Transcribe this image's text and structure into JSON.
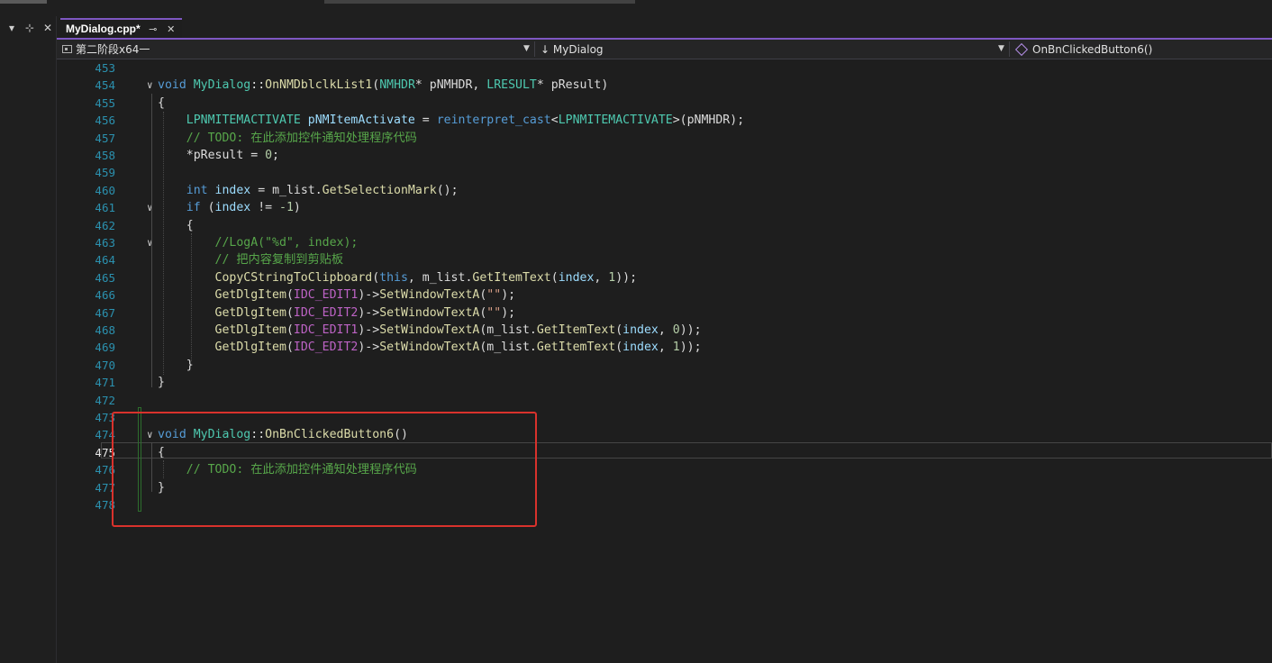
{
  "tab": {
    "title": "MyDialog.cpp*",
    "pin": "⊸",
    "close": "✕"
  },
  "left_panel": {
    "buttons": [
      "▾",
      "⊹",
      "✕"
    ]
  },
  "nav": {
    "project": "第二阶段x64一",
    "class_scope": "↓ MyDialog",
    "member": "OnBnClickedButton6()"
  },
  "code": {
    "current_line": 475,
    "lines": [
      {
        "n": 453,
        "tokens": []
      },
      {
        "n": 454,
        "fold": "v",
        "tokens": [
          [
            "kw",
            "void"
          ],
          [
            "pl",
            " "
          ],
          [
            "ty",
            "MyDialog"
          ],
          [
            "pl",
            "::"
          ],
          [
            "fn",
            "OnNMDblclkList1"
          ],
          [
            "pl",
            "("
          ],
          [
            "ty",
            "NMHDR"
          ],
          [
            "pl",
            "* pNMHDR, "
          ],
          [
            "ty",
            "LRESULT"
          ],
          [
            "pl",
            "* pResult)"
          ]
        ]
      },
      {
        "n": 455,
        "tokens": [
          [
            "pl",
            "{"
          ]
        ]
      },
      {
        "n": 456,
        "tokens": [
          [
            "pl",
            "    "
          ],
          [
            "ty",
            "LPNMITEMACTIVATE"
          ],
          [
            "pl",
            " "
          ],
          [
            "id",
            "pNMItemActivate"
          ],
          [
            "pl",
            " = "
          ],
          [
            "kw",
            "reinterpret_cast"
          ],
          [
            "pl",
            "<"
          ],
          [
            "ty",
            "LPNMITEMACTIVATE"
          ],
          [
            "pl",
            ">(pNMHDR);"
          ]
        ]
      },
      {
        "n": 457,
        "tokens": [
          [
            "pl",
            "    "
          ],
          [
            "cm",
            "// TODO: 在此添加控件通知处理程序代码"
          ]
        ]
      },
      {
        "n": 458,
        "tokens": [
          [
            "pl",
            "    *pResult = "
          ],
          [
            "nm",
            "0"
          ],
          [
            "pl",
            ";"
          ]
        ]
      },
      {
        "n": 459,
        "tokens": []
      },
      {
        "n": 460,
        "tokens": [
          [
            "pl",
            "    "
          ],
          [
            "kw",
            "int"
          ],
          [
            "pl",
            " "
          ],
          [
            "id",
            "index"
          ],
          [
            "pl",
            " = m_list."
          ],
          [
            "fn",
            "GetSelectionMark"
          ],
          [
            "pl",
            "();"
          ]
        ]
      },
      {
        "n": 461,
        "fold": "v",
        "tokens": [
          [
            "pl",
            "    "
          ],
          [
            "kw",
            "if"
          ],
          [
            "pl",
            " ("
          ],
          [
            "id",
            "index"
          ],
          [
            "pl",
            " != "
          ],
          [
            "nm",
            "-1"
          ],
          [
            "pl",
            ")"
          ]
        ]
      },
      {
        "n": 462,
        "tokens": [
          [
            "pl",
            "    {"
          ]
        ]
      },
      {
        "n": 463,
        "fold": "v",
        "tokens": [
          [
            "pl",
            "        "
          ],
          [
            "cm",
            "//LogA(\"%d\", index);"
          ]
        ]
      },
      {
        "n": 464,
        "tokens": [
          [
            "pl",
            "        "
          ],
          [
            "cm",
            "// 把内容复制到剪贴板"
          ]
        ]
      },
      {
        "n": 465,
        "tokens": [
          [
            "pl",
            "        "
          ],
          [
            "fn",
            "CopyCStringToClipboard"
          ],
          [
            "pl",
            "("
          ],
          [
            "kw",
            "this"
          ],
          [
            "pl",
            ", m_list."
          ],
          [
            "fn",
            "GetItemText"
          ],
          [
            "pl",
            "("
          ],
          [
            "id",
            "index"
          ],
          [
            "pl",
            ", "
          ],
          [
            "nm",
            "1"
          ],
          [
            "pl",
            "));"
          ]
        ]
      },
      {
        "n": 466,
        "tokens": [
          [
            "pl",
            "        "
          ],
          [
            "fn",
            "GetDlgItem"
          ],
          [
            "pl",
            "("
          ],
          [
            "mc",
            "IDC_EDIT1"
          ],
          [
            "pl",
            ")->"
          ],
          [
            "fn",
            "SetWindowTextA"
          ],
          [
            "pl",
            "("
          ],
          [
            "st",
            "\"\""
          ],
          [
            "pl",
            ");"
          ]
        ]
      },
      {
        "n": 467,
        "tokens": [
          [
            "pl",
            "        "
          ],
          [
            "fn",
            "GetDlgItem"
          ],
          [
            "pl",
            "("
          ],
          [
            "mc",
            "IDC_EDIT2"
          ],
          [
            "pl",
            ")->"
          ],
          [
            "fn",
            "SetWindowTextA"
          ],
          [
            "pl",
            "("
          ],
          [
            "st",
            "\"\""
          ],
          [
            "pl",
            ");"
          ]
        ]
      },
      {
        "n": 468,
        "tokens": [
          [
            "pl",
            "        "
          ],
          [
            "fn",
            "GetDlgItem"
          ],
          [
            "pl",
            "("
          ],
          [
            "mc",
            "IDC_EDIT1"
          ],
          [
            "pl",
            ")->"
          ],
          [
            "fn",
            "SetWindowTextA"
          ],
          [
            "pl",
            "(m_list."
          ],
          [
            "fn",
            "GetItemText"
          ],
          [
            "pl",
            "("
          ],
          [
            "id",
            "index"
          ],
          [
            "pl",
            ", "
          ],
          [
            "nm",
            "0"
          ],
          [
            "pl",
            "));"
          ]
        ]
      },
      {
        "n": 469,
        "tokens": [
          [
            "pl",
            "        "
          ],
          [
            "fn",
            "GetDlgItem"
          ],
          [
            "pl",
            "("
          ],
          [
            "mc",
            "IDC_EDIT2"
          ],
          [
            "pl",
            ")->"
          ],
          [
            "fn",
            "SetWindowTextA"
          ],
          [
            "pl",
            "(m_list."
          ],
          [
            "fn",
            "GetItemText"
          ],
          [
            "pl",
            "("
          ],
          [
            "id",
            "index"
          ],
          [
            "pl",
            ", "
          ],
          [
            "nm",
            "1"
          ],
          [
            "pl",
            "));"
          ]
        ]
      },
      {
        "n": 470,
        "tokens": [
          [
            "pl",
            "    }"
          ]
        ]
      },
      {
        "n": 471,
        "tokens": [
          [
            "pl",
            "}"
          ]
        ]
      },
      {
        "n": 472,
        "tokens": []
      },
      {
        "n": 473,
        "tokens": []
      },
      {
        "n": 474,
        "fold": "v",
        "tokens": [
          [
            "kw",
            "void"
          ],
          [
            "pl",
            " "
          ],
          [
            "ty",
            "MyDialog"
          ],
          [
            "pl",
            "::"
          ],
          [
            "fn",
            "OnBnClickedButton6"
          ],
          [
            "pl",
            "()"
          ]
        ]
      },
      {
        "n": 475,
        "tokens": [
          [
            "pl",
            "{"
          ]
        ]
      },
      {
        "n": 476,
        "tokens": [
          [
            "pl",
            "    "
          ],
          [
            "cm",
            "// TODO: 在此添加控件通知处理程序代码"
          ]
        ]
      },
      {
        "n": 477,
        "tokens": [
          [
            "pl",
            "}"
          ]
        ]
      },
      {
        "n": 478,
        "tokens": []
      }
    ]
  },
  "colors": {
    "accent": "#7e57c2",
    "highlight_box": "#d9322c",
    "line_number": "#2b91af",
    "change_bar": "#2d6e2d"
  }
}
